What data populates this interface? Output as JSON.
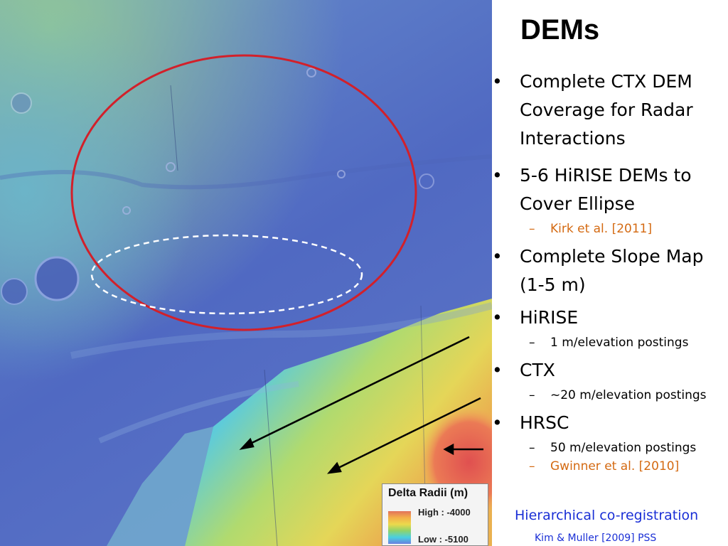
{
  "slide": {
    "title": "DEMs",
    "bullets": [
      {
        "text": "Complete CTX DEM Coverage for Radar Interactions"
      },
      {
        "text": "5-6 HiRISE DEMs to Cover Ellipse"
      },
      {
        "text": "Kirk et al. [2011]"
      },
      {
        "text": "Complete Slope Map (1-5 m)"
      },
      {
        "text": "HiRISE"
      },
      {
        "text": "1 m/elevation postings"
      },
      {
        "text": "CTX"
      },
      {
        "text": "~20 m/elevation postings"
      },
      {
        "text": "HRSC"
      },
      {
        "text": "50 m/elevation postings"
      },
      {
        "text": "Gwinner et al. [2010]"
      }
    ],
    "footer_line1": "Hierarchical co-registration",
    "footer_line2": "Kim & Muller [2009] PSS"
  },
  "legend": {
    "title": "Delta Radii (m)",
    "high_label": "High : -4000",
    "low_label": "Low : -5100"
  },
  "colors": {
    "ellipse_red": "#d2202a",
    "ellipse_dashed": "#ffffff",
    "reference_orange": "#d46a12",
    "footer_blue": "#1a2fd6"
  }
}
